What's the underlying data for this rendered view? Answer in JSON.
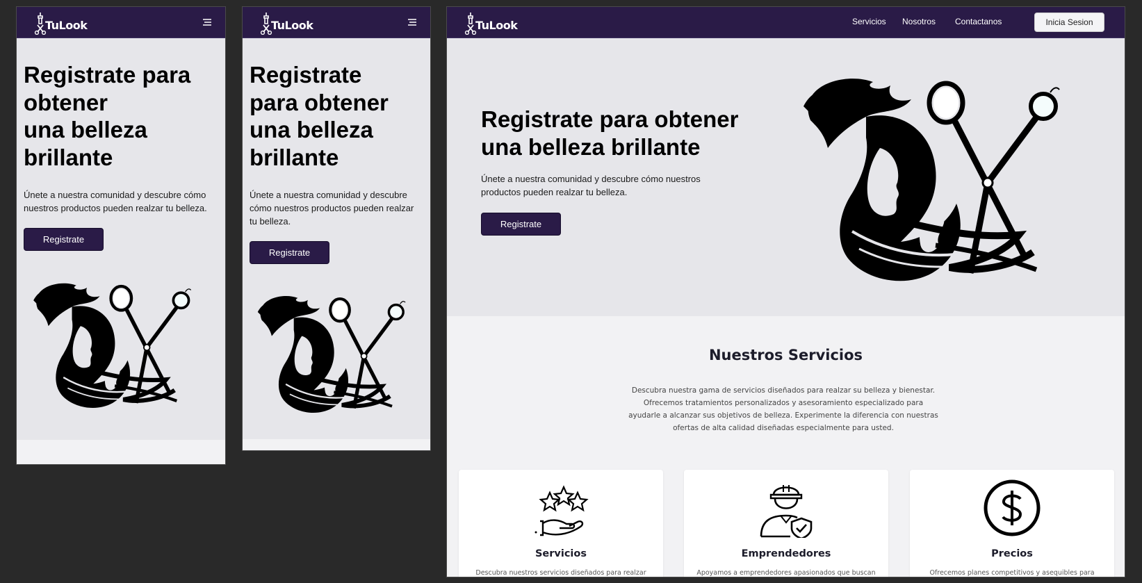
{
  "brand": {
    "name": "TuLook",
    "logo_icon": "scissors-bottle-logo"
  },
  "colors": {
    "nav_bg": "#2a1b47",
    "hero_bg": "#e6e6ea",
    "section_bg": "#f2f2f4",
    "page_bg": "#292929",
    "button_bg": "#2a1b47"
  },
  "mobile_a": {
    "menu_icon": "hamburger-menu-icon",
    "hero": {
      "title_lines": [
        "Registrate para",
        "obtener",
        "una belleza",
        "brillante"
      ],
      "subtitle": "Únete a nuestra comunidad y descubre cómo nuestros productos pueden realzar tu belleza.",
      "cta": "Registrate"
    }
  },
  "mobile_b": {
    "menu_icon": "hamburger-menu-icon",
    "hero": {
      "title_lines": [
        "Registrate",
        "para obtener",
        "una belleza",
        "brillante"
      ],
      "subtitle": "Únete a nuestra comunidad y descubre cómo nuestros productos pueden realzar tu belleza.",
      "cta": "Registrate"
    }
  },
  "desktop": {
    "nav": {
      "links": [
        "Servicios",
        "Nosotros",
        "Contactanos"
      ],
      "login": "Inicia Sesion"
    },
    "hero": {
      "title_lines": [
        "Registrate para obtener",
        "una belleza brillante"
      ],
      "subtitle_lines": [
        "Únete a nuestra comunidad y descubre cómo nuestros",
        "productos pueden realzar tu belleza."
      ],
      "cta": "Registrate",
      "illustration": "hair-salon-face-scissors-illustration"
    },
    "services": {
      "title": "Nuestros Servicios",
      "description": "Descubra nuestra gama de servicios diseñados para realzar su belleza y bienestar. Ofrecemos tratamientos personalizados y asesoramiento especializado para ayudarle a alcanzar sus objetivos de belleza. Experimente la diferencia con nuestras ofertas de alta calidad diseñadas especialmente para usted.",
      "cards": [
        {
          "icon": "stars-hand-icon",
          "title": "Servicios",
          "text": "Descubra nuestros servicios diseñados para realzar su"
        },
        {
          "icon": "worker-shield-icon",
          "title": "Emprendedores",
          "text": "Apoyamos a emprendedores apasionados que buscan"
        },
        {
          "icon": "dollar-coin-icon",
          "title": "Precios",
          "text": "Ofrecemos planes competitivos y asequibles para que"
        }
      ]
    }
  }
}
